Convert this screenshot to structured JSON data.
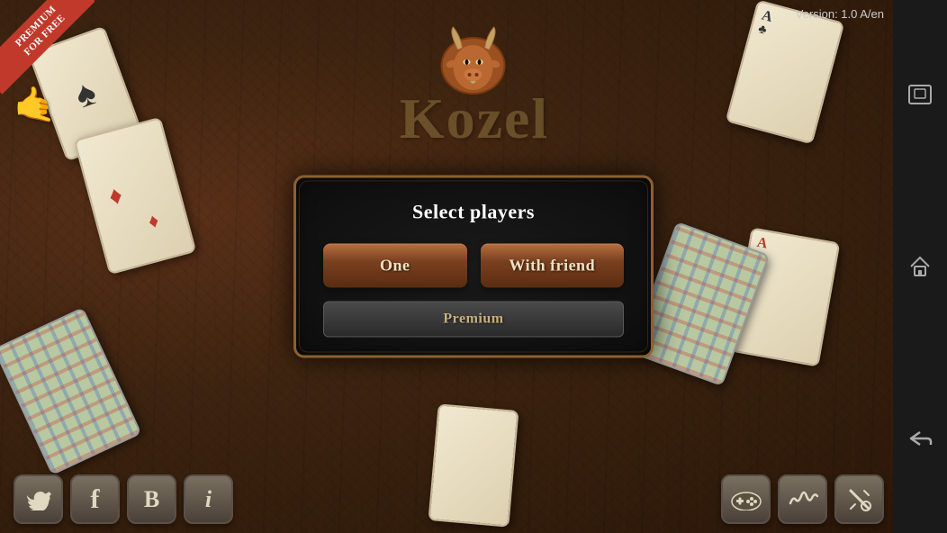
{
  "app": {
    "version": "Version: 1.0 A/en"
  },
  "premium_badge": {
    "line1": "PREMIUM",
    "line2": "FOR FREE"
  },
  "dialog": {
    "title": "Select players",
    "btn_one": "One",
    "btn_friend": "With friend",
    "btn_premium": "Premium"
  },
  "sidebar": {
    "window_icon": "⬜",
    "home_icon": "⌂",
    "back_icon": "↩"
  },
  "bottom_bar": {
    "twitter_label": "𝕏",
    "facebook_label": "f",
    "blog_label": "B",
    "info_label": "i",
    "gamepad_label": "🎮",
    "wave_label": "〜",
    "tools_label": "✂"
  }
}
